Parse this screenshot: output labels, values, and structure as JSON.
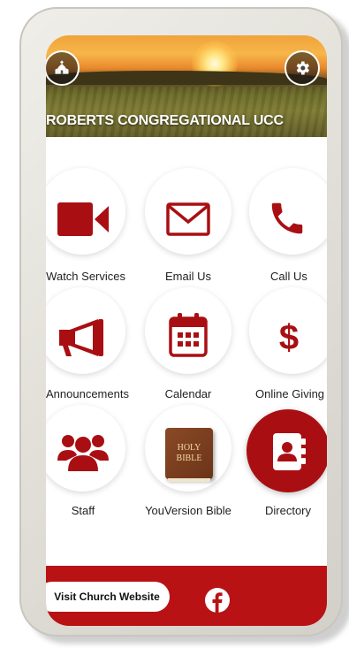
{
  "header": {
    "title": "ROBERTS CONGREGATIONAL UCC",
    "left_icon": "church-icon",
    "right_icon": "gear-icon"
  },
  "tiles": [
    {
      "label": "Watch Services",
      "icon": "video-camera-icon"
    },
    {
      "label": "Email Us",
      "icon": "envelope-icon"
    },
    {
      "label": "Call Us",
      "icon": "phone-icon"
    },
    {
      "label": "Announcements",
      "icon": "megaphone-icon"
    },
    {
      "label": "Calendar",
      "icon": "calendar-icon"
    },
    {
      "label": "Online Giving",
      "icon": "dollar-icon"
    },
    {
      "label": "Staff",
      "icon": "people-icon"
    },
    {
      "label": "YouVersion Bible",
      "icon": "bible-icon",
      "bible_line1": "HOLY",
      "bible_line2": "BIBLE"
    },
    {
      "label": "Directory",
      "icon": "address-book-icon",
      "selected": true
    }
  ],
  "footer": {
    "visit_label": "Visit Church Website",
    "social_icon": "facebook-icon"
  },
  "colors": {
    "accent": "#a90f12",
    "footer": "#b81214",
    "icon": "#a90f12"
  }
}
